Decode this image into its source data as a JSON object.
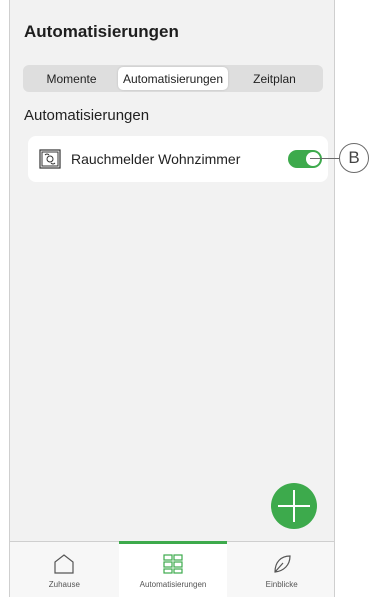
{
  "header": {
    "title": "Automatisierungen"
  },
  "segments": [
    {
      "label": "Momente"
    },
    {
      "label": "Automatisierungen",
      "active": true
    },
    {
      "label": "Zeitplan"
    }
  ],
  "section": {
    "title": "Automatisierungen"
  },
  "automation": {
    "label": "Rauchmelder Wohnzimmer",
    "icon": "smoke-detector-icon",
    "enabled": true
  },
  "fab": {
    "icon": "plus-icon"
  },
  "tabbar": [
    {
      "label": "Zuhause",
      "icon": "home-icon"
    },
    {
      "label": "Automatisierungen",
      "icon": "grid-icon",
      "active": true
    },
    {
      "label": "Einblicke",
      "icon": "leaf-icon"
    }
  ],
  "callout": {
    "label": "B"
  },
  "colors": {
    "accent": "#3daa4c",
    "background": "#f2f2f2"
  }
}
